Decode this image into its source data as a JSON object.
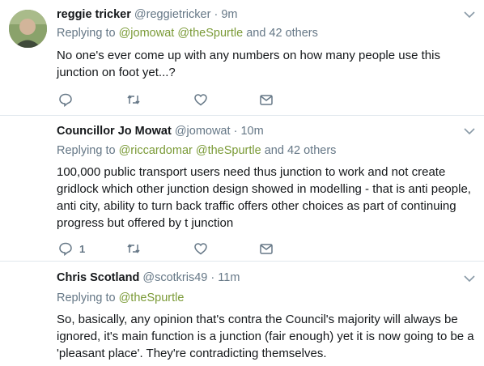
{
  "colors": {
    "text": "#14171a",
    "muted": "#657786",
    "mention": "#7a9a36",
    "divider": "#e1e8ed"
  },
  "tweets": [
    {
      "name": "reggie tricker",
      "handle": "@reggietricker",
      "separator": "·",
      "time": "9m",
      "replying_prefix": "Replying to",
      "mentions": [
        "@jomowat",
        "@theSpurtle"
      ],
      "replying_suffix": "and 42 others",
      "text": "No one's ever come up with any numbers on how many people use this junction on foot yet...?",
      "reply_count": "",
      "icons": [
        "reply-icon",
        "retweet-icon",
        "like-icon",
        "message-icon"
      ]
    },
    {
      "name": "Councillor Jo Mowat",
      "handle": "@jomowat",
      "separator": "·",
      "time": "10m",
      "replying_prefix": "Replying to",
      "mentions": [
        "@riccardomar",
        "@theSpurtle"
      ],
      "replying_suffix": "and 42 others",
      "text": "100,000 public transport users need thus junction to work and not  create gridlock which other junction design showed in modelling - that is anti people, anti city, ability to turn back traffic offers other choices as part of continuing progress but offered by t junction",
      "reply_count": "1",
      "icons": [
        "reply-icon",
        "retweet-icon",
        "like-icon",
        "message-icon"
      ]
    },
    {
      "name": "Chris Scotland",
      "handle": "@scotkris49",
      "separator": "·",
      "time": "11m",
      "replying_prefix": "Replying to",
      "mentions": [
        "@theSpurtle"
      ],
      "replying_suffix": "",
      "text": "So, basically, any opinion that's contra the Council's majority will always be ignored, it's main function is a junction (fair enough) yet it is now going to be a 'pleasant place'. They're contradicting themselves.",
      "reply_count": "",
      "icons": [
        "reply-icon",
        "retweet-icon",
        "like-icon",
        "message-icon"
      ]
    }
  ]
}
